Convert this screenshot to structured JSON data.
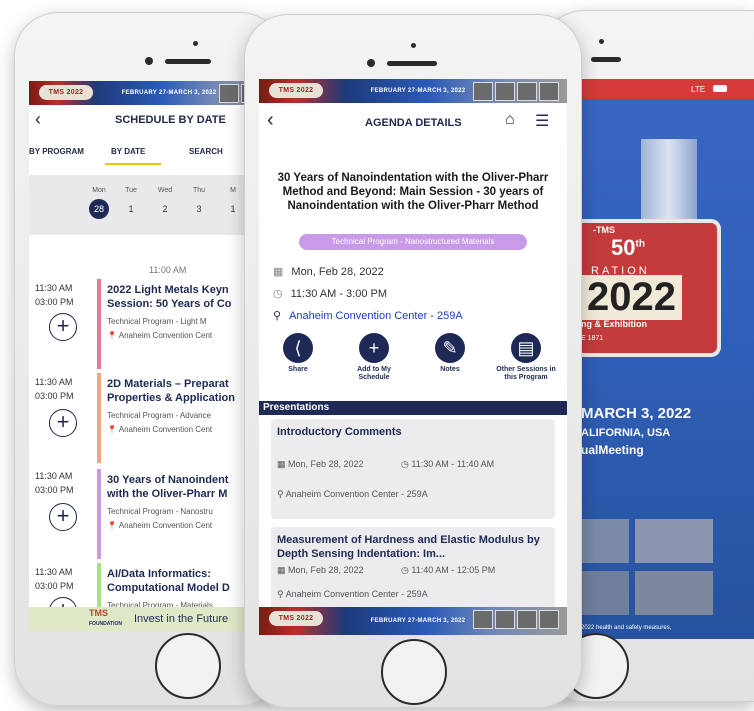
{
  "banner": {
    "logo": "TMS 2022",
    "dates": "FEBRUARY 27-MARCH 3, 2022",
    "location": "ANAHEIM, CALIFORNIA, USA • #TMSAnnualMeeting"
  },
  "left": {
    "title": "SCHEDULE BY DATE",
    "tabs": [
      "BY PROGRAM",
      "BY DATE",
      "SEARCH"
    ],
    "days": [
      {
        "name": "Mon",
        "num": "28",
        "selected": true
      },
      {
        "name": "Tue",
        "num": "1"
      },
      {
        "name": "Wed",
        "num": "2"
      },
      {
        "name": "Thu",
        "num": "3"
      },
      {
        "name": "M",
        "num": "1"
      }
    ],
    "time_divider": "11:00 AM",
    "sessions": [
      {
        "start": "11:30 AM",
        "end": "03:00 PM",
        "title1": "2022 Light Metals Keyn",
        "title2": "Session: 50 Years of Co",
        "program": "Technical Program - Light M",
        "place": "Anaheim Convention Cent",
        "color": "#e87a96"
      },
      {
        "start": "11:30 AM",
        "end": "03:00 PM",
        "title1": "2D Materials – Preparat",
        "title2": "Properties & Application",
        "program": "Technical Program - Advance",
        "place": "Anaheim Convention Cent",
        "color": "#f4a57c"
      },
      {
        "start": "11:30 AM",
        "end": "03:00 PM",
        "title1": "30 Years of Nanoindent",
        "title2": "with the Oliver-Pharr M",
        "program": "Technical Program - Nanostru",
        "place": "Anaheim Convention Cent",
        "color": "#c99ae8"
      },
      {
        "start": "11:30 AM",
        "end": "03:00 PM",
        "title1": "AI/Data Informatics:",
        "title2": "Computational Model D",
        "program": "Technical Program - Materials",
        "place": "",
        "color": "#a6e27a"
      }
    ],
    "footer": {
      "logo": "TMS",
      "logo_sub": "FOUNDATION",
      "text": "Invest in the Future"
    }
  },
  "middle": {
    "title": "AGENDA DETAILS",
    "session_title": "30 Years of Nanoindentation with the Oliver-Pharr Method and Beyond: Main Session - 30 years of Nanoindentation with the Oliver-Pharr Method",
    "category": "Technical Program - Nanostructured Materials",
    "date": "Mon, Feb 28, 2022",
    "time": "11:30 AM - 3:00 PM",
    "location": "Anaheim Convention Center - 259A",
    "actions": [
      {
        "label": "Share",
        "icon": "share-icon"
      },
      {
        "label": "Add to My Schedule",
        "icon": "plus-icon"
      },
      {
        "label": "Notes",
        "icon": "pencil-icon"
      },
      {
        "label": "Other Sessions in this Program",
        "icon": "document-icon"
      }
    ],
    "presentations_header": "Presentations",
    "presentations": [
      {
        "title": "Introductory Comments",
        "date": "Mon, Feb 28, 2022",
        "time": "11:30 AM - 11:40 AM",
        "place": "Anaheim Convention Center - 259A"
      },
      {
        "title": "Measurement of Hardness and Elastic Modulus by Depth Sensing Indentation: Im...",
        "date": "Mon, Feb 28, 2022",
        "time": "11:40 AM - 12:05 PM",
        "place": "Anaheim Convention Center - 259A"
      }
    ]
  },
  "right": {
    "status": "LTE",
    "event_year": "2022",
    "event_line1": "RATION",
    "event_line2": "ng & Exhibition",
    "event_founded": "E 1871",
    "event_logo": "-TMS",
    "event_50": "50",
    "event_50_sup": "th",
    "dates": "MARCH 3, 2022",
    "location": "ALIFORNIA, USA",
    "hashtag": "ualMeeting",
    "footnote": "2022 health and safety measures,"
  },
  "colors": {
    "navy": "#1e2a55",
    "accent_purple": "#c99ae8",
    "link_blue": "#1a3fbf"
  }
}
